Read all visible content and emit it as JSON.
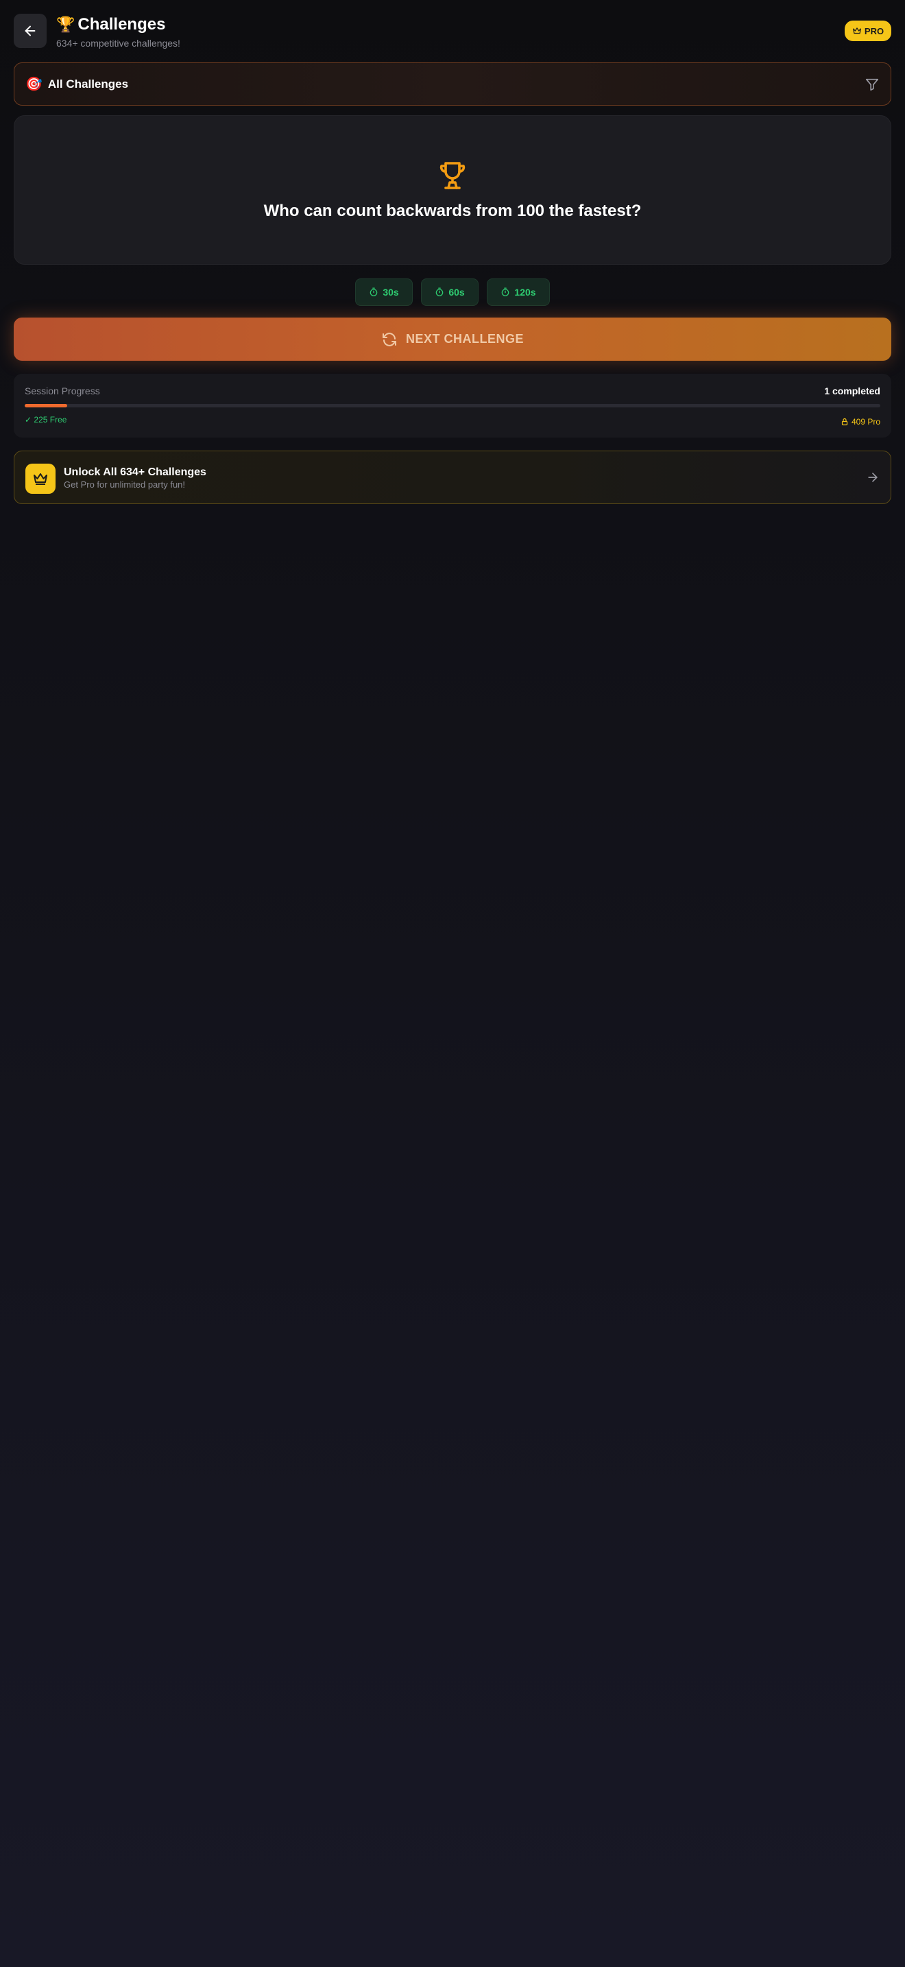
{
  "header": {
    "title": "Challenges",
    "title_emoji": "🏆",
    "subtitle": "634+ competitive challenges!",
    "pro_badge": "PRO",
    "back_icon": "arrow-left-icon",
    "crown_icon": "crown-icon"
  },
  "filter": {
    "emoji": "🎯",
    "label": "All Challenges",
    "icon": "filter-icon"
  },
  "challenge": {
    "icon": "trophy-icon",
    "question": "Who can count backwards from 100 the fastest?"
  },
  "timers": [
    {
      "label": "30s",
      "icon": "timer-icon"
    },
    {
      "label": "60s",
      "icon": "timer-icon"
    },
    {
      "label": "120s",
      "icon": "timer-icon"
    }
  ],
  "next_button": {
    "label": "NEXT CHALLENGE",
    "icon": "refresh-icon"
  },
  "progress": {
    "label": "Session Progress",
    "count": "1 completed",
    "fraction": 0.05,
    "free": "✓ 225 Free",
    "pro": "409 Pro",
    "lock_icon": "lock-icon"
  },
  "unlock": {
    "title": "Unlock All 634+ Challenges",
    "subtitle": "Get Pro for unlimited party fun!",
    "icon": "crown-icon",
    "arrow_icon": "arrow-right-icon"
  },
  "colors": {
    "accent_orange": "#f06a2e",
    "pro_yellow": "#f5c518",
    "timer_green": "#2ecc71"
  }
}
